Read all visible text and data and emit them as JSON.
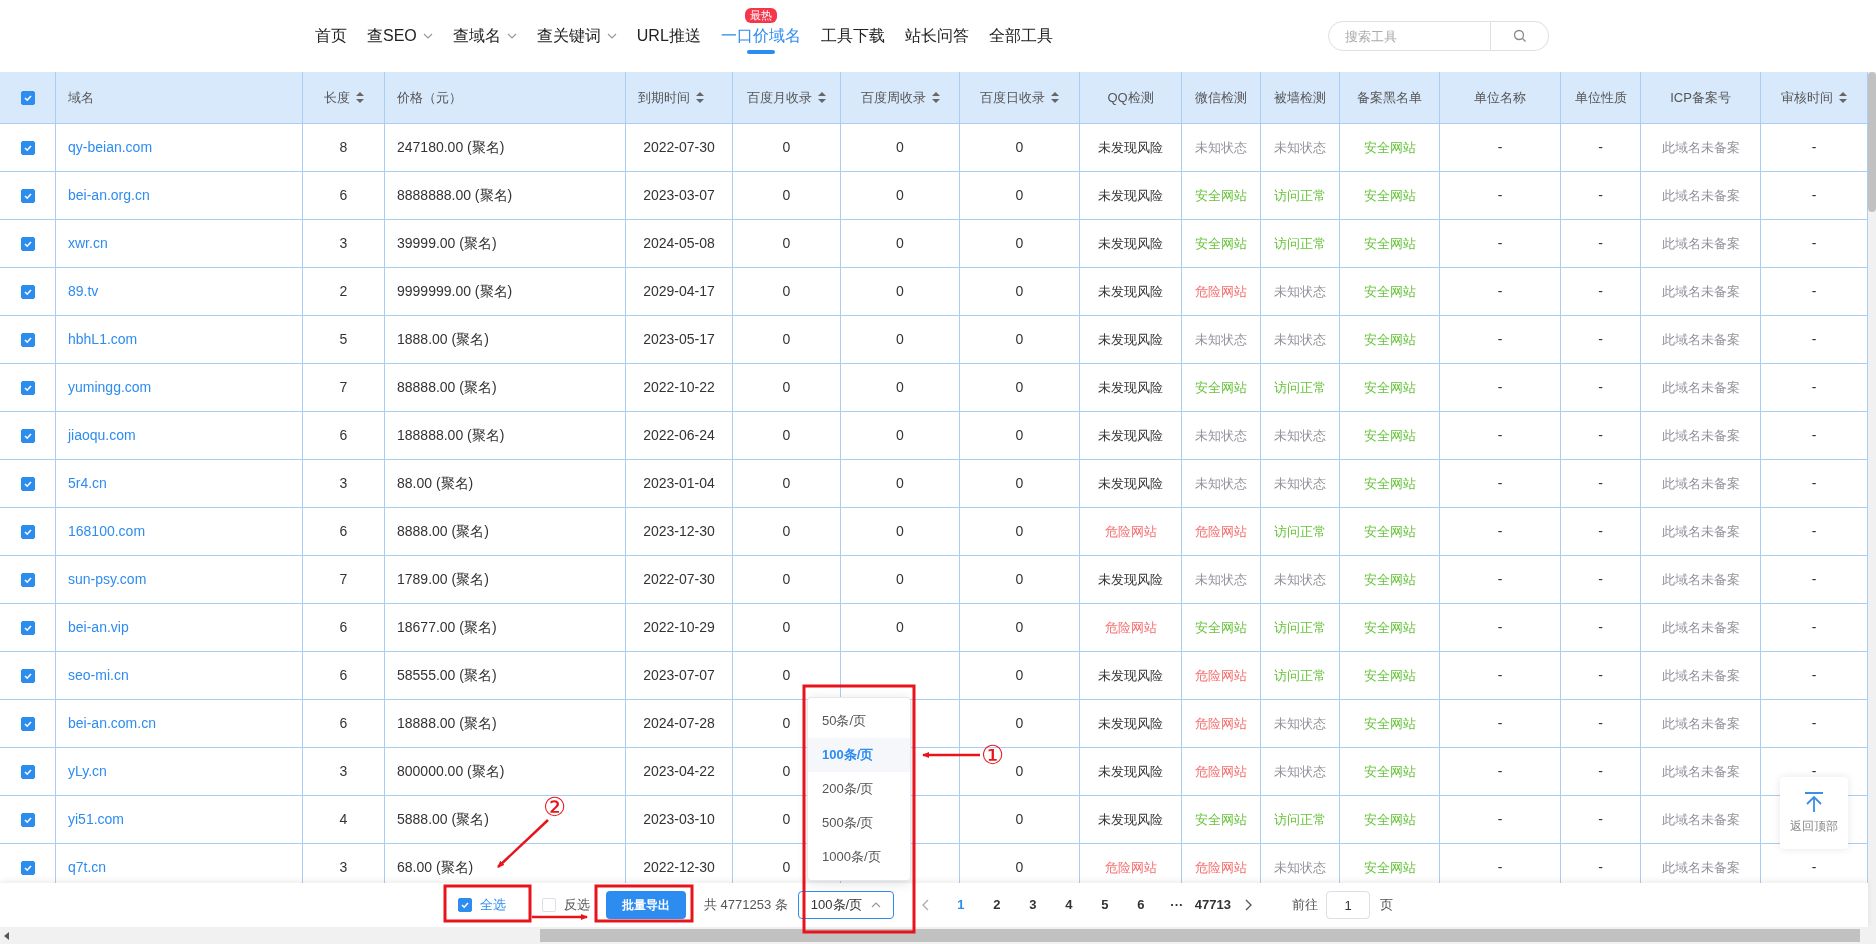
{
  "nav": {
    "items": [
      {
        "label": "首页",
        "dropdown": false,
        "selected": false
      },
      {
        "label": "查SEO",
        "dropdown": true,
        "selected": false
      },
      {
        "label": "查域名",
        "dropdown": true,
        "selected": false
      },
      {
        "label": "查关键词",
        "dropdown": true,
        "selected": false
      },
      {
        "label": "URL推送",
        "dropdown": false,
        "selected": false
      },
      {
        "label": "一口价域名",
        "dropdown": false,
        "selected": true,
        "badge": "最热"
      },
      {
        "label": "工具下载",
        "dropdown": false,
        "selected": false
      },
      {
        "label": "站长问答",
        "dropdown": false,
        "selected": false
      },
      {
        "label": "全部工具",
        "dropdown": false,
        "selected": false
      }
    ],
    "search": {
      "placeholder": "搜索工具"
    }
  },
  "table": {
    "header_checked": true,
    "columns": [
      {
        "label": "域名",
        "sortable": false
      },
      {
        "label": "长度",
        "sortable": true
      },
      {
        "label": "价格（元）",
        "sortable": false
      },
      {
        "label": "到期时间",
        "sortable": true
      },
      {
        "label": "百度月收录",
        "sortable": true
      },
      {
        "label": "百度周收录",
        "sortable": true
      },
      {
        "label": "百度日收录",
        "sortable": true
      },
      {
        "label": "QQ检测",
        "sortable": false
      },
      {
        "label": "微信检测",
        "sortable": false
      },
      {
        "label": "被墙检测",
        "sortable": false
      },
      {
        "label": "备案黑名单",
        "sortable": false
      },
      {
        "label": "单位名称",
        "sortable": false
      },
      {
        "label": "单位性质",
        "sortable": false
      },
      {
        "label": "ICP备案号",
        "sortable": false
      },
      {
        "label": "审核时间",
        "sortable": true
      }
    ],
    "rows": [
      {
        "checked": true,
        "cells": [
          "qy-beian.com",
          "8",
          "247180.00 (聚名)",
          "2022-07-30",
          "0",
          "0",
          "0",
          {
            "text": "未发现风险",
            "kind": "ok"
          },
          {
            "text": "未知状态",
            "kind": "unknown"
          },
          {
            "text": "未知状态",
            "kind": "unknown"
          },
          {
            "text": "安全网站",
            "kind": "safe"
          },
          "-",
          "-",
          "此域名未备案",
          "-"
        ]
      },
      {
        "checked": true,
        "cells": [
          "bei-an.org.cn",
          "6",
          "8888888.00 (聚名)",
          "2023-03-07",
          "0",
          "0",
          "0",
          {
            "text": "未发现风险",
            "kind": "ok"
          },
          {
            "text": "安全网站",
            "kind": "safe"
          },
          {
            "text": "访问正常",
            "kind": "safe"
          },
          {
            "text": "安全网站",
            "kind": "safe"
          },
          "-",
          "-",
          "此域名未备案",
          "-"
        ]
      },
      {
        "checked": true,
        "cells": [
          "xwr.cn",
          "3",
          "39999.00 (聚名)",
          "2024-05-08",
          "0",
          "0",
          "0",
          {
            "text": "未发现风险",
            "kind": "ok"
          },
          {
            "text": "安全网站",
            "kind": "safe"
          },
          {
            "text": "访问正常",
            "kind": "safe"
          },
          {
            "text": "安全网站",
            "kind": "safe"
          },
          "-",
          "-",
          "此域名未备案",
          "-"
        ]
      },
      {
        "checked": true,
        "cells": [
          "89.tv",
          "2",
          "9999999.00 (聚名)",
          "2029-04-17",
          "0",
          "0",
          "0",
          {
            "text": "未发现风险",
            "kind": "ok"
          },
          {
            "text": "危险网站",
            "kind": "danger"
          },
          {
            "text": "未知状态",
            "kind": "unknown"
          },
          {
            "text": "安全网站",
            "kind": "safe"
          },
          "-",
          "-",
          "此域名未备案",
          "-"
        ]
      },
      {
        "checked": true,
        "cells": [
          "hbhL1.com",
          "5",
          "1888.00 (聚名)",
          "2023-05-17",
          "0",
          "0",
          "0",
          {
            "text": "未发现风险",
            "kind": "ok"
          },
          {
            "text": "未知状态",
            "kind": "unknown"
          },
          {
            "text": "未知状态",
            "kind": "unknown"
          },
          {
            "text": "安全网站",
            "kind": "safe"
          },
          "-",
          "-",
          "此域名未备案",
          "-"
        ]
      },
      {
        "checked": true,
        "cells": [
          "yumingg.com",
          "7",
          "88888.00 (聚名)",
          "2022-10-22",
          "0",
          "0",
          "0",
          {
            "text": "未发现风险",
            "kind": "ok"
          },
          {
            "text": "安全网站",
            "kind": "safe"
          },
          {
            "text": "访问正常",
            "kind": "safe"
          },
          {
            "text": "安全网站",
            "kind": "safe"
          },
          "-",
          "-",
          "此域名未备案",
          "-"
        ]
      },
      {
        "checked": true,
        "cells": [
          "jiaoqu.com",
          "6",
          "188888.00 (聚名)",
          "2022-06-24",
          "0",
          "0",
          "0",
          {
            "text": "未发现风险",
            "kind": "ok"
          },
          {
            "text": "未知状态",
            "kind": "unknown"
          },
          {
            "text": "未知状态",
            "kind": "unknown"
          },
          {
            "text": "安全网站",
            "kind": "safe"
          },
          "-",
          "-",
          "此域名未备案",
          "-"
        ]
      },
      {
        "checked": true,
        "cells": [
          "5r4.cn",
          "3",
          "88.00 (聚名)",
          "2023-01-04",
          "0",
          "0",
          "0",
          {
            "text": "未发现风险",
            "kind": "ok"
          },
          {
            "text": "未知状态",
            "kind": "unknown"
          },
          {
            "text": "未知状态",
            "kind": "unknown"
          },
          {
            "text": "安全网站",
            "kind": "safe"
          },
          "-",
          "-",
          "此域名未备案",
          "-"
        ]
      },
      {
        "checked": true,
        "cells": [
          "168100.com",
          "6",
          "8888.00 (聚名)",
          "2023-12-30",
          "0",
          "0",
          "0",
          {
            "text": "危险网站",
            "kind": "danger"
          },
          {
            "text": "危险网站",
            "kind": "danger"
          },
          {
            "text": "访问正常",
            "kind": "safe"
          },
          {
            "text": "安全网站",
            "kind": "safe"
          },
          "-",
          "-",
          "此域名未备案",
          "-"
        ]
      },
      {
        "checked": true,
        "cells": [
          "sun-psy.com",
          "7",
          "1789.00 (聚名)",
          "2022-07-30",
          "0",
          "0",
          "0",
          {
            "text": "未发现风险",
            "kind": "ok"
          },
          {
            "text": "未知状态",
            "kind": "unknown"
          },
          {
            "text": "未知状态",
            "kind": "unknown"
          },
          {
            "text": "安全网站",
            "kind": "safe"
          },
          "-",
          "-",
          "此域名未备案",
          "-"
        ]
      },
      {
        "checked": true,
        "cells": [
          "bei-an.vip",
          "6",
          "18677.00 (聚名)",
          "2022-10-29",
          "0",
          "0",
          "0",
          {
            "text": "危险网站",
            "kind": "danger"
          },
          {
            "text": "安全网站",
            "kind": "safe"
          },
          {
            "text": "访问正常",
            "kind": "safe"
          },
          {
            "text": "安全网站",
            "kind": "safe"
          },
          "-",
          "-",
          "此域名未备案",
          "-"
        ]
      },
      {
        "checked": true,
        "cells": [
          "seo-mi.cn",
          "6",
          "58555.00 (聚名)",
          "2023-07-07",
          "0",
          null,
          "0",
          {
            "text": "未发现风险",
            "kind": "ok"
          },
          {
            "text": "危险网站",
            "kind": "danger"
          },
          {
            "text": "访问正常",
            "kind": "safe"
          },
          {
            "text": "安全网站",
            "kind": "safe"
          },
          "-",
          "-",
          "此域名未备案",
          "-"
        ]
      },
      {
        "checked": true,
        "cells": [
          "bei-an.com.cn",
          "6",
          "18888.00 (聚名)",
          "2024-07-28",
          "0",
          null,
          "0",
          {
            "text": "未发现风险",
            "kind": "ok"
          },
          {
            "text": "危险网站",
            "kind": "danger"
          },
          {
            "text": "未知状态",
            "kind": "unknown"
          },
          {
            "text": "安全网站",
            "kind": "safe"
          },
          "-",
          "-",
          "此域名未备案",
          "-"
        ]
      },
      {
        "checked": true,
        "cells": [
          "yLy.cn",
          "3",
          "800000.00 (聚名)",
          "2023-04-22",
          "0",
          null,
          "0",
          {
            "text": "未发现风险",
            "kind": "ok"
          },
          {
            "text": "危险网站",
            "kind": "danger"
          },
          {
            "text": "未知状态",
            "kind": "unknown"
          },
          {
            "text": "安全网站",
            "kind": "safe"
          },
          "-",
          "-",
          "此域名未备案",
          "-"
        ]
      },
      {
        "checked": true,
        "cells": [
          "yi51.com",
          "4",
          "5888.00 (聚名)",
          "2023-03-10",
          "0",
          null,
          "0",
          {
            "text": "未发现风险",
            "kind": "ok"
          },
          {
            "text": "安全网站",
            "kind": "safe"
          },
          {
            "text": "访问正常",
            "kind": "safe"
          },
          {
            "text": "安全网站",
            "kind": "safe"
          },
          "-",
          "-",
          "此域名未备案",
          null
        ]
      },
      {
        "checked": true,
        "cells": [
          "q7t.cn",
          "3",
          "68.00 (聚名)",
          "2022-12-30",
          "0",
          null,
          "0",
          {
            "text": "危险网站",
            "kind": "danger"
          },
          {
            "text": "危险网站",
            "kind": "danger"
          },
          {
            "text": "未知状态",
            "kind": "unknown"
          },
          {
            "text": "安全网站",
            "kind": "safe"
          },
          "-",
          "-",
          "此域名未备案",
          "-"
        ]
      }
    ]
  },
  "page_size_menu": {
    "options": [
      {
        "label": "50条/页",
        "selected": false
      },
      {
        "label": "100条/页",
        "selected": true
      },
      {
        "label": "200条/页",
        "selected": false
      },
      {
        "label": "500条/页",
        "selected": false
      },
      {
        "label": "1000条/页",
        "selected": false
      }
    ]
  },
  "back_to_top": {
    "label": "返回顶部"
  },
  "footer": {
    "select_all": {
      "label": "全选",
      "checked": true
    },
    "invert": {
      "label": "反选",
      "checked": false
    },
    "export_button": "批量导出",
    "total": "共 4771253 条",
    "page_size": "100条/页",
    "pages": [
      {
        "label": "1",
        "selected": true
      },
      {
        "label": "2",
        "selected": false
      },
      {
        "label": "3",
        "selected": false
      },
      {
        "label": "4",
        "selected": false
      },
      {
        "label": "5",
        "selected": false
      },
      {
        "label": "6",
        "selected": false
      },
      {
        "label": "···",
        "selected": false
      },
      {
        "label": "47713",
        "selected": false
      }
    ],
    "goto": {
      "label": "前往",
      "value": "1",
      "suffix": "页"
    }
  },
  "annotations": {
    "markers": [
      "①",
      "②"
    ]
  }
}
